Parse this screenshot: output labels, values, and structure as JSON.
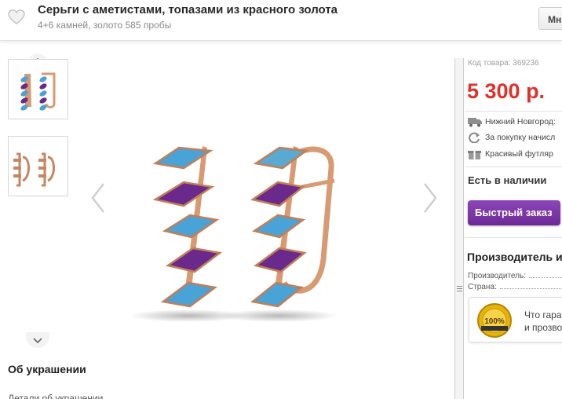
{
  "header": {
    "title": "Серьги с аметистами, топазами из красного золота",
    "subtitle": "4+6 камней, золото 585 пробы",
    "more_button": "Мн"
  },
  "gallery": {
    "thumbnails": [
      "earrings-front-thumbnail",
      "earrings-side-thumbnail"
    ]
  },
  "about": {
    "title": "Об украшении",
    "subtitle": "Детали об украшении"
  },
  "product": {
    "sku": "Код товара: 369236",
    "price": "5 300 р.",
    "delivery": "Нижний Новгород:",
    "bonus": "За покупку начисл",
    "gift": "Красивый футляр",
    "stock": "Есть в наличии",
    "quick_order": "Быстрый заказ"
  },
  "manufacturer": {
    "title": "Производитель и",
    "rows": [
      {
        "label": "Производитель:"
      },
      {
        "label": "Страна:"
      }
    ]
  },
  "guarantee": {
    "line1": "Что гара",
    "line2": "и прозво"
  },
  "colors": {
    "price": "#e0302a",
    "button": "#7b36a6",
    "amethyst": "#6a2a8c",
    "topaz": "#4aa3d6",
    "gold": "#d89a73"
  },
  "icons": [
    "heart-icon",
    "chevron-up-icon",
    "chevron-down-icon",
    "chevron-left-icon",
    "chevron-right-icon",
    "truck-icon",
    "refresh-icon",
    "gift-icon",
    "guarantee-badge-icon"
  ]
}
